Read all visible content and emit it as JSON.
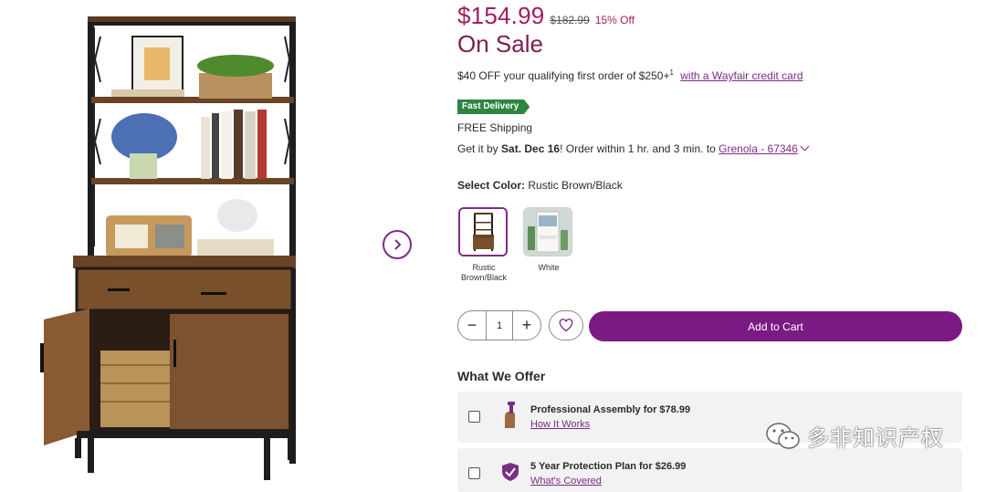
{
  "product": {
    "price": "$154.99",
    "was_price": "$182.99",
    "discount": "15% Off",
    "sale_label": "On Sale",
    "promo_text": "$40 OFF your qualifying first order of $250+",
    "promo_sup": "1",
    "promo_link": "with a Wayfair credit card",
    "badge": "Fast Delivery",
    "shipping": "FREE Shipping",
    "delivery_prefix": "Get it by ",
    "delivery_date": "Sat. Dec 16",
    "delivery_middle": "! Order within 1 hr. and 3 min. to ",
    "delivery_location": "Grenola - 67346"
  },
  "color": {
    "label": "Select Color:",
    "selected": "Rustic Brown/Black",
    "options": [
      {
        "label": "Rustic Brown/Black"
      },
      {
        "label": "White"
      }
    ]
  },
  "cart": {
    "quantity": "1",
    "minus": "−",
    "plus": "+",
    "add_label": "Add to Cart"
  },
  "offers": {
    "heading": "What We Offer",
    "items": [
      {
        "title": "Professional Assembly for $78.99",
        "link": "How It Works",
        "icon": "assembly-hand-icon"
      },
      {
        "title": "5 Year Protection Plan for $26.99",
        "link": "What's Covered",
        "icon": "shield-check-icon"
      }
    ]
  },
  "watermark": {
    "text": "多非知识产权",
    "icon": "wechat-icon"
  },
  "colors": {
    "accent": "#7b1a82",
    "price": "#a21d5d",
    "badge": "#2e8540"
  }
}
